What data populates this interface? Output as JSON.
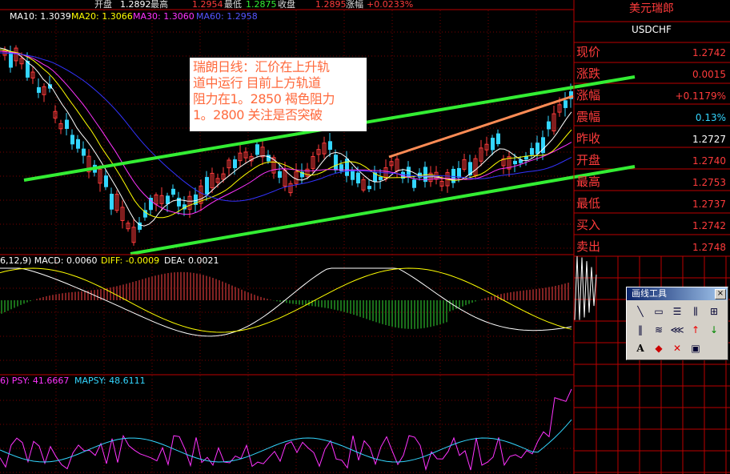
{
  "header": {
    "open_label": "开盘",
    "open_value": "1.2892",
    "high_label": "最高",
    "high_value": "1.2954",
    "low_label": "最低",
    "low_value": "1.2875",
    "close_label": "收盘",
    "close_value": "1.2895",
    "change_label": "涨幅",
    "change_value": "+0.0233%"
  },
  "ma_legend": {
    "ma10": "MA10: 1.3039",
    "ma20": "MA20: 1.3066",
    "ma30": "MA30: 1.3060",
    "ma60": "MA60: 1.2958"
  },
  "macd_legend": {
    "params": "6,12,9) MACD: 0.0060",
    "diff": "DIFF: -0.0009",
    "dea": "DEA: 0.0021"
  },
  "psy_legend": {
    "psy": "6) PSY: 41.6667",
    "mapsy": "MAPSY: 48.6111"
  },
  "annotation": {
    "line1": "瑞朗日线：汇价在上升轨",
    "line2": "道中运行 目前上方轨道",
    "line3": "阻力在1。2850 褐色阻力",
    "line4": "1。2800 关注是否突破"
  },
  "quote_panel": {
    "name": "美元瑞郎",
    "symbol": "USDCHF",
    "rows": [
      {
        "label": "现价",
        "value": "1.2742",
        "color": "#ff3b3b"
      },
      {
        "label": "涨跌",
        "value": "0.0015",
        "color": "#ff3b3b"
      },
      {
        "label": "涨幅",
        "value": "+0.1179%",
        "color": "#ff3b3b"
      },
      {
        "label": "震幅",
        "value": "0.13%",
        "color": "#33d6ff"
      },
      {
        "label": "昨收",
        "value": "1.2727",
        "color": "#ffffff"
      },
      {
        "label": "开盘",
        "value": "1.2740",
        "color": "#ff3b3b"
      },
      {
        "label": "最高",
        "value": "1.2753",
        "color": "#ff3b3b"
      },
      {
        "label": "最低",
        "value": "1.2737",
        "color": "#ff3b3b"
      },
      {
        "label": "买入",
        "value": "1.2742",
        "color": "#ff3b3b"
      },
      {
        "label": "卖出",
        "value": "1.2748",
        "color": "#ff3b3b"
      }
    ]
  },
  "toolbox": {
    "title": "画线工具",
    "close": "×",
    "tools": [
      {
        "name": "line-tool-icon",
        "glyph": "╲"
      },
      {
        "name": "rectangle-tool-icon",
        "glyph": "▭"
      },
      {
        "name": "parallel-lines-tool-icon",
        "glyph": "☰"
      },
      {
        "name": "gann-tool-icon",
        "glyph": "⫼"
      },
      {
        "name": "fibonacci-tool-icon",
        "glyph": "⊞"
      },
      {
        "name": "period-lines-tool-icon",
        "glyph": "‖"
      },
      {
        "name": "speed-lines-tool-icon",
        "glyph": "≋"
      },
      {
        "name": "fan-lines-tool-icon",
        "glyph": "⋘"
      },
      {
        "name": "up-arrow-tool-icon",
        "glyph": "↑"
      },
      {
        "name": "down-arrow-tool-icon",
        "glyph": "↓"
      },
      {
        "name": "text-tool-icon",
        "glyph": "A"
      },
      {
        "name": "eraser-tool-icon",
        "glyph": "◆"
      },
      {
        "name": "delete-tool-icon",
        "glyph": "✕"
      },
      {
        "name": "save-tool-icon",
        "glyph": "▣"
      }
    ]
  },
  "colors": {
    "up": "#ff3b3b",
    "down": "#33d6ff",
    "grid": "#7a0000",
    "trend": "#33ee33",
    "resistance": "#ff8c55",
    "ma10": "#ffffff",
    "ma20": "#ffff00",
    "ma30": "#ff33ff",
    "ma60": "#3333ff"
  }
}
